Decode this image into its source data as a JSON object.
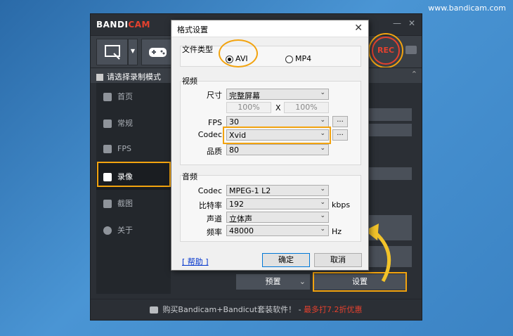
{
  "watermark": "www.bandicam.com",
  "app": {
    "logo_part1": "BANDI",
    "logo_part2": "CAM",
    "rec_label": "REC",
    "mode_label": "请选择录制模式",
    "sidebar": [
      {
        "label": "首页",
        "icon": "home-icon"
      },
      {
        "label": "常规",
        "icon": "gear-icon"
      },
      {
        "label": "FPS",
        "icon": "fps-icon"
      },
      {
        "label": "录像",
        "icon": "video-icon",
        "active": true
      },
      {
        "label": "截图",
        "icon": "image-icon"
      },
      {
        "label": "关于",
        "icon": "info-icon"
      }
    ],
    "preset_label": "预置",
    "setting_label": "设置",
    "footer_text": "购买Bandicam+Bandicut套装软件！ - ",
    "footer_highlight": "最多打7.2折优惠"
  },
  "dialog": {
    "title": "格式设置",
    "file_type_label": "文件类型",
    "avi_label": "AVI",
    "mp4_label": "MP4",
    "selected_type": "AVI",
    "video_label": "视频",
    "size_label": "尺寸",
    "size_value": "完整屏幕",
    "width_pct": "100%",
    "x_label": "X",
    "height_pct": "100%",
    "fps_label": "FPS",
    "fps_value": "30",
    "codec_label": "Codec",
    "codec_value": "Xvid",
    "quality_label": "品质",
    "quality_value": "80",
    "dots": "...",
    "audio_label": "音频",
    "audio_codec_label": "Codec",
    "audio_codec_value": "MPEG-1 L2",
    "bitrate_label": "比特率",
    "bitrate_value": "192",
    "bitrate_unit": "kbps",
    "channel_label": "声道",
    "channel_value": "立体声",
    "freq_label": "频率",
    "freq_value": "48000",
    "freq_unit": "Hz",
    "help_label": "[ 帮助 ]",
    "ok_label": "确定",
    "cancel_label": "取消"
  },
  "colors": {
    "accent": "#f2a30f",
    "brand_red": "#e5412e",
    "window_bg": "#2b2f35"
  }
}
